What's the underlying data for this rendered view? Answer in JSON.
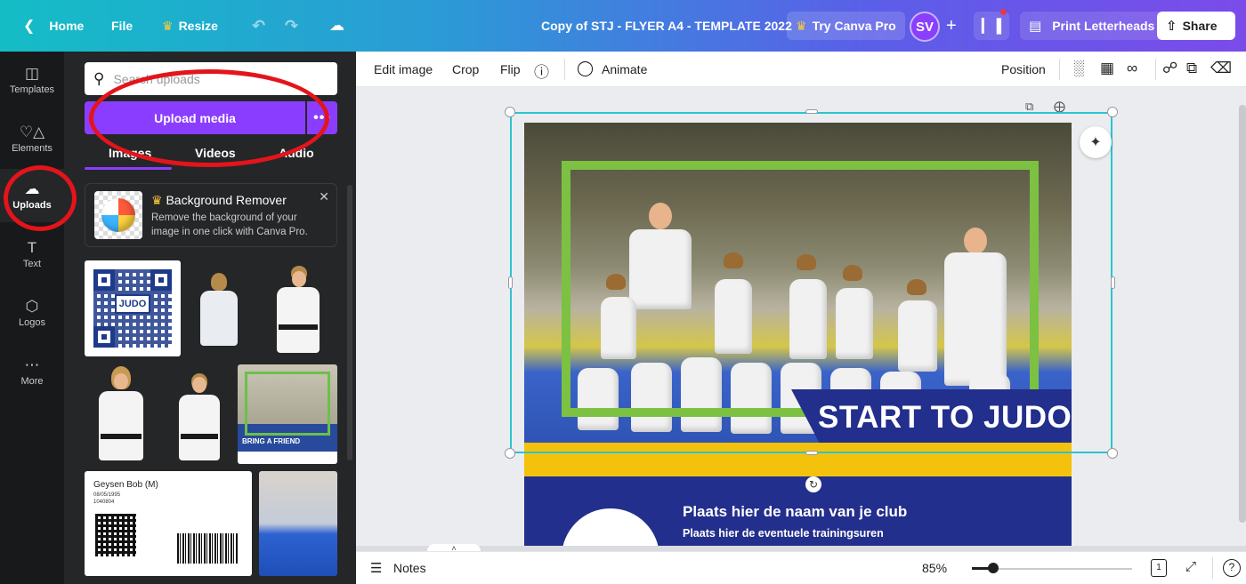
{
  "topbar": {
    "home": "Home",
    "file": "File",
    "resize": "Resize",
    "doc_title": "Copy of STJ - FLYER A4 - TEMPLATE 2022",
    "try_pro": "Try Canva Pro",
    "avatar_initials": "SV",
    "print": "Print Letterheads",
    "share": "Share"
  },
  "rail": [
    {
      "label": "Templates",
      "icon": "templates-icon"
    },
    {
      "label": "Elements",
      "icon": "elements-icon"
    },
    {
      "label": "Uploads",
      "icon": "upload-cloud-icon"
    },
    {
      "label": "Text",
      "icon": "text-icon"
    },
    {
      "label": "Logos",
      "icon": "logos-icon"
    },
    {
      "label": "More",
      "icon": "more-icon"
    }
  ],
  "panel": {
    "search_placeholder": "Search uploads",
    "upload_button": "Upload media",
    "more_button": "•••",
    "tabs": [
      "Images",
      "Videos",
      "Audio"
    ],
    "bg_remover": {
      "title": "Background Remover",
      "desc": "Remove the background of your image in one click with Canva Pro."
    },
    "thumbs": {
      "qr_logo": "JUDO",
      "bring_friend": "BRING A FRIEND",
      "card_name": "Geysen Bob (M)",
      "card_date": "08/05/1995",
      "card_id": "1040804"
    }
  },
  "toolbar": {
    "edit_image": "Edit image",
    "crop": "Crop",
    "flip": "Flip",
    "animate": "Animate",
    "position": "Position"
  },
  "design": {
    "banner": "START TO JUDO",
    "club": "Plaats hier de naam van je club",
    "hours": "Plaats hier de eventuele trainingsuren"
  },
  "bottombar": {
    "notes": "Notes",
    "zoom": "85%",
    "page_num": "1",
    "help": "?"
  },
  "colors": {
    "accent_purple": "#8b3dff",
    "selection": "#2bc4d0",
    "annotation_red": "#e4141b",
    "flyer_navy": "#232f8c",
    "flyer_yellow": "#f4c20d",
    "flyer_green": "#7cc142"
  }
}
